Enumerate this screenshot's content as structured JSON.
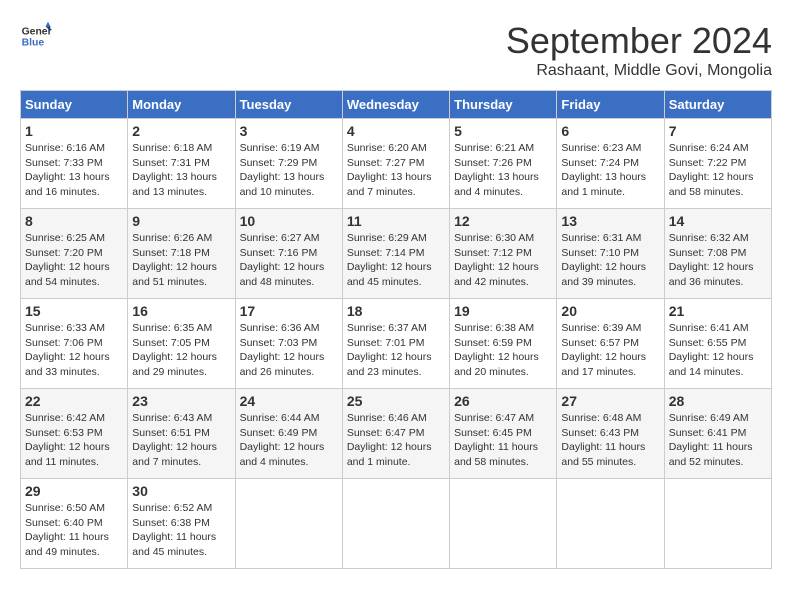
{
  "header": {
    "logo_line1": "General",
    "logo_line2": "Blue",
    "title": "September 2024",
    "subtitle": "Rashaant, Middle Govi, Mongolia"
  },
  "days_of_week": [
    "Sunday",
    "Monday",
    "Tuesday",
    "Wednesday",
    "Thursday",
    "Friday",
    "Saturday"
  ],
  "weeks": [
    [
      {
        "day": "1",
        "info": "Sunrise: 6:16 AM\nSunset: 7:33 PM\nDaylight: 13 hours\nand 16 minutes."
      },
      {
        "day": "2",
        "info": "Sunrise: 6:18 AM\nSunset: 7:31 PM\nDaylight: 13 hours\nand 13 minutes."
      },
      {
        "day": "3",
        "info": "Sunrise: 6:19 AM\nSunset: 7:29 PM\nDaylight: 13 hours\nand 10 minutes."
      },
      {
        "day": "4",
        "info": "Sunrise: 6:20 AM\nSunset: 7:27 PM\nDaylight: 13 hours\nand 7 minutes."
      },
      {
        "day": "5",
        "info": "Sunrise: 6:21 AM\nSunset: 7:26 PM\nDaylight: 13 hours\nand 4 minutes."
      },
      {
        "day": "6",
        "info": "Sunrise: 6:23 AM\nSunset: 7:24 PM\nDaylight: 13 hours\nand 1 minute."
      },
      {
        "day": "7",
        "info": "Sunrise: 6:24 AM\nSunset: 7:22 PM\nDaylight: 12 hours\nand 58 minutes."
      }
    ],
    [
      {
        "day": "8",
        "info": "Sunrise: 6:25 AM\nSunset: 7:20 PM\nDaylight: 12 hours\nand 54 minutes."
      },
      {
        "day": "9",
        "info": "Sunrise: 6:26 AM\nSunset: 7:18 PM\nDaylight: 12 hours\nand 51 minutes."
      },
      {
        "day": "10",
        "info": "Sunrise: 6:27 AM\nSunset: 7:16 PM\nDaylight: 12 hours\nand 48 minutes."
      },
      {
        "day": "11",
        "info": "Sunrise: 6:29 AM\nSunset: 7:14 PM\nDaylight: 12 hours\nand 45 minutes."
      },
      {
        "day": "12",
        "info": "Sunrise: 6:30 AM\nSunset: 7:12 PM\nDaylight: 12 hours\nand 42 minutes."
      },
      {
        "day": "13",
        "info": "Sunrise: 6:31 AM\nSunset: 7:10 PM\nDaylight: 12 hours\nand 39 minutes."
      },
      {
        "day": "14",
        "info": "Sunrise: 6:32 AM\nSunset: 7:08 PM\nDaylight: 12 hours\nand 36 minutes."
      }
    ],
    [
      {
        "day": "15",
        "info": "Sunrise: 6:33 AM\nSunset: 7:06 PM\nDaylight: 12 hours\nand 33 minutes."
      },
      {
        "day": "16",
        "info": "Sunrise: 6:35 AM\nSunset: 7:05 PM\nDaylight: 12 hours\nand 29 minutes."
      },
      {
        "day": "17",
        "info": "Sunrise: 6:36 AM\nSunset: 7:03 PM\nDaylight: 12 hours\nand 26 minutes."
      },
      {
        "day": "18",
        "info": "Sunrise: 6:37 AM\nSunset: 7:01 PM\nDaylight: 12 hours\nand 23 minutes."
      },
      {
        "day": "19",
        "info": "Sunrise: 6:38 AM\nSunset: 6:59 PM\nDaylight: 12 hours\nand 20 minutes."
      },
      {
        "day": "20",
        "info": "Sunrise: 6:39 AM\nSunset: 6:57 PM\nDaylight: 12 hours\nand 17 minutes."
      },
      {
        "day": "21",
        "info": "Sunrise: 6:41 AM\nSunset: 6:55 PM\nDaylight: 12 hours\nand 14 minutes."
      }
    ],
    [
      {
        "day": "22",
        "info": "Sunrise: 6:42 AM\nSunset: 6:53 PM\nDaylight: 12 hours\nand 11 minutes."
      },
      {
        "day": "23",
        "info": "Sunrise: 6:43 AM\nSunset: 6:51 PM\nDaylight: 12 hours\nand 7 minutes."
      },
      {
        "day": "24",
        "info": "Sunrise: 6:44 AM\nSunset: 6:49 PM\nDaylight: 12 hours\nand 4 minutes."
      },
      {
        "day": "25",
        "info": "Sunrise: 6:46 AM\nSunset: 6:47 PM\nDaylight: 12 hours\nand 1 minute."
      },
      {
        "day": "26",
        "info": "Sunrise: 6:47 AM\nSunset: 6:45 PM\nDaylight: 11 hours\nand 58 minutes."
      },
      {
        "day": "27",
        "info": "Sunrise: 6:48 AM\nSunset: 6:43 PM\nDaylight: 11 hours\nand 55 minutes."
      },
      {
        "day": "28",
        "info": "Sunrise: 6:49 AM\nSunset: 6:41 PM\nDaylight: 11 hours\nand 52 minutes."
      }
    ],
    [
      {
        "day": "29",
        "info": "Sunrise: 6:50 AM\nSunset: 6:40 PM\nDaylight: 11 hours\nand 49 minutes."
      },
      {
        "day": "30",
        "info": "Sunrise: 6:52 AM\nSunset: 6:38 PM\nDaylight: 11 hours\nand 45 minutes."
      },
      null,
      null,
      null,
      null,
      null
    ]
  ]
}
